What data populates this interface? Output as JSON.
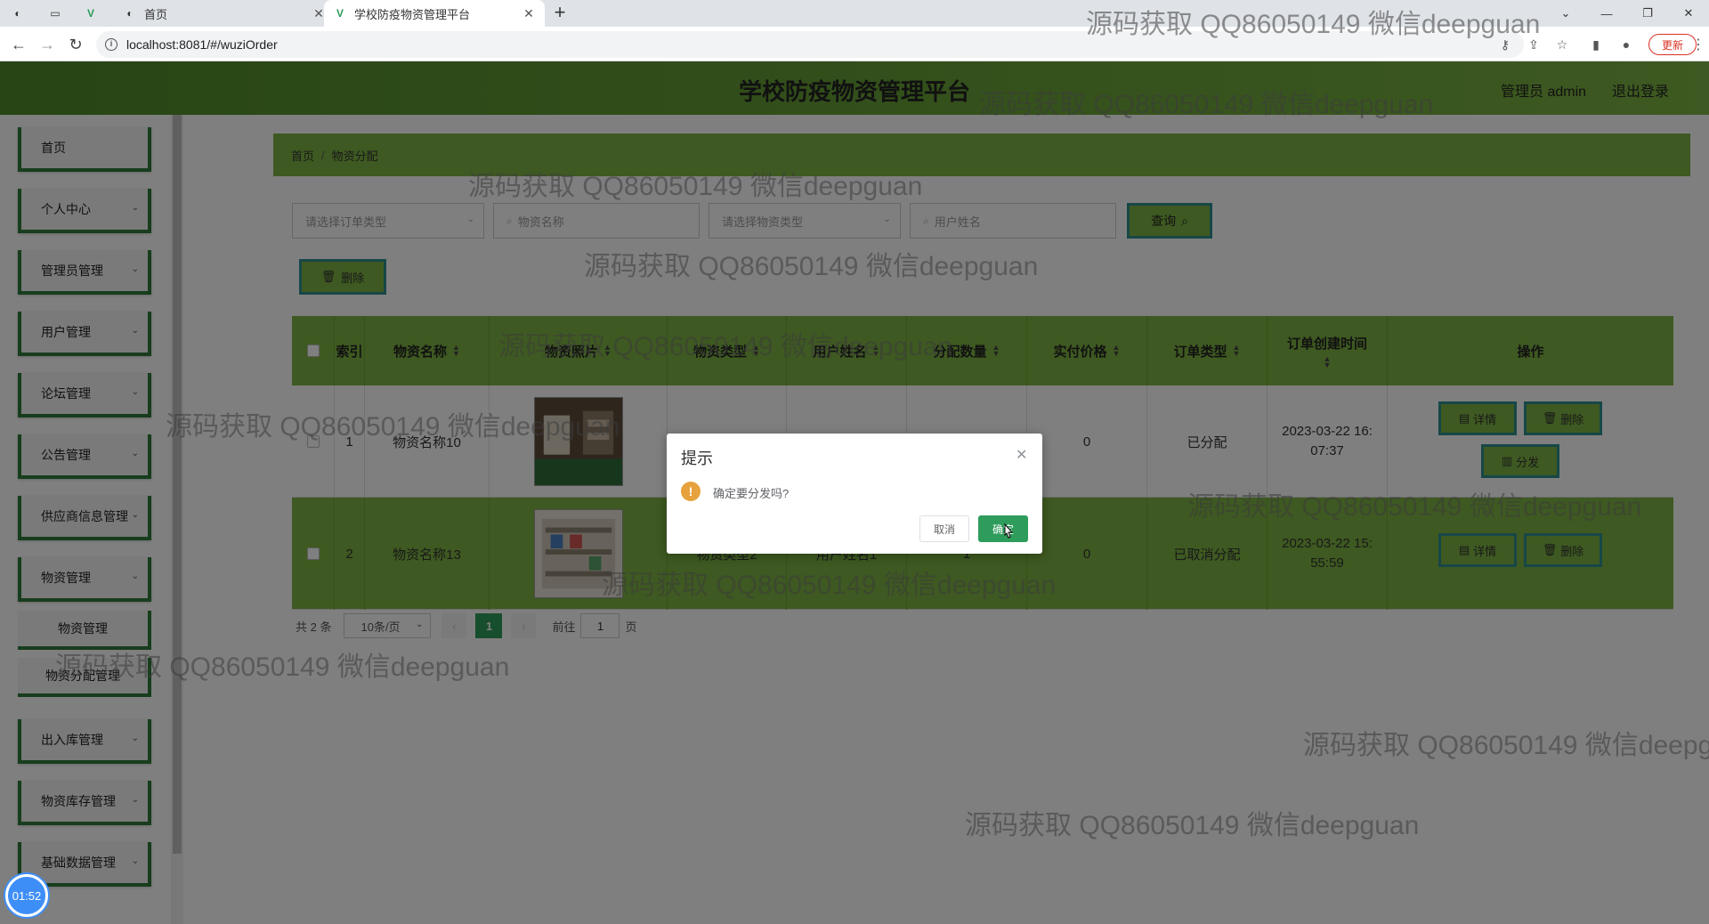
{
  "browser": {
    "tabs": [
      {
        "title": "首页",
        "active": false
      },
      {
        "title": "学校防疫物资管理平台",
        "active": true
      }
    ],
    "url": "localhost:8081/#/wuziOrder",
    "update_label": "更新"
  },
  "header": {
    "title": "学校防疫物资管理平台",
    "user": "管理员 admin",
    "logout": "退出登录"
  },
  "sidebar": {
    "items": [
      {
        "label": "首页"
      },
      {
        "label": "个人中心"
      },
      {
        "label": "管理员管理"
      },
      {
        "label": "用户管理"
      },
      {
        "label": "论坛管理"
      },
      {
        "label": "公告管理"
      },
      {
        "label": "供应商信息管理"
      },
      {
        "label": "物资管理"
      }
    ],
    "subitems": [
      {
        "label": "物资管理"
      },
      {
        "label": "物资分配管理"
      }
    ],
    "items_after": [
      {
        "label": "出入库管理"
      },
      {
        "label": "物资库存管理"
      },
      {
        "label": "基础数据管理"
      }
    ],
    "clock": "01:52"
  },
  "breadcrumb": {
    "home": "首页",
    "current": "物资分配",
    "sep": "/"
  },
  "filters": {
    "order_type_placeholder": "请选择订单类型",
    "name_placeholder": "物资名称",
    "type_placeholder": "请选择物资类型",
    "user_placeholder": "用户姓名",
    "query_label": "查询"
  },
  "batch_delete_label": "删除",
  "table": {
    "headers": [
      "索引",
      "物资名称",
      "物资照片",
      "物资类型",
      "用户姓名",
      "分配数量",
      "实付价格",
      "订单类型",
      "订单创建时间",
      "操作"
    ],
    "rows": [
      {
        "index": "1",
        "name": "物资名称10",
        "type": "",
        "user": "",
        "qty": "",
        "price": "0",
        "order_type": "已分配",
        "created": "2023-03-22 16:07:37"
      },
      {
        "index": "2",
        "name": "物资名称13",
        "type": "物资类型2",
        "user": "用户姓名1",
        "qty": "1",
        "price": "0",
        "order_type": "已取消分配",
        "created": "2023-03-22 15:55:59"
      }
    ],
    "detail_label": "详情",
    "delete_label": "删除",
    "distribute_label": "分发"
  },
  "pagination": {
    "total": "共 2 条",
    "page_size": "10条/页",
    "current": "1",
    "goto_prefix": "前往",
    "goto_value": "1",
    "goto_suffix": "页"
  },
  "dialog": {
    "title": "提示",
    "message": "确定要分发吗?",
    "cancel": "取消",
    "ok": "确定"
  },
  "watermark": "源码获取 QQ86050149 微信deepguan",
  "colors": {
    "header_green": "#7cb342",
    "accent_teal": "#2f8e8e",
    "primary_green": "#2e9c5b",
    "warning": "#e6a23c"
  }
}
